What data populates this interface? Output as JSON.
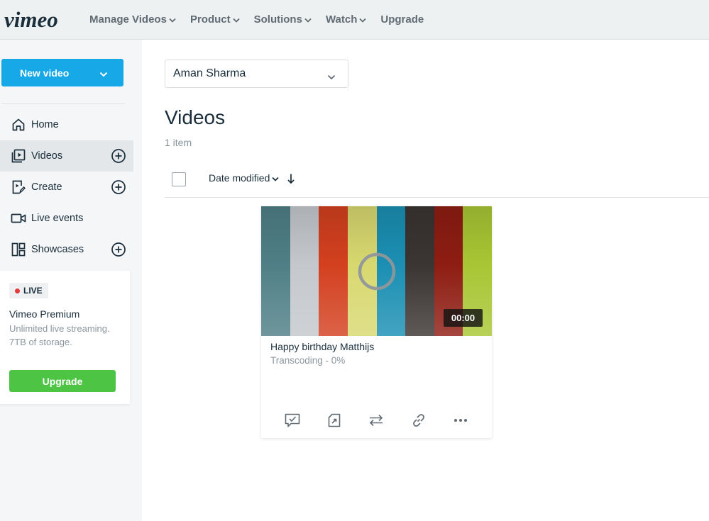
{
  "app": {
    "logo_text": "vimeo",
    "brand_color": "#17a8e8"
  },
  "topnav": {
    "items": [
      {
        "label": "Manage Videos",
        "has_dropdown": true
      },
      {
        "label": "Product",
        "has_dropdown": true
      },
      {
        "label": "Solutions",
        "has_dropdown": true
      },
      {
        "label": "Watch",
        "has_dropdown": true
      },
      {
        "label": "Upgrade",
        "has_dropdown": false
      }
    ]
  },
  "sidebar": {
    "new_video_label": "New video",
    "items": [
      {
        "label": "Home",
        "icon": "home-icon",
        "active": false,
        "has_add": false
      },
      {
        "label": "Videos",
        "icon": "video-library-icon",
        "active": true,
        "has_add": true
      },
      {
        "label": "Create",
        "icon": "create-icon",
        "active": false,
        "has_add": true
      },
      {
        "label": "Live events",
        "icon": "camera-icon",
        "active": false,
        "has_add": false
      },
      {
        "label": "Showcases",
        "icon": "showcases-icon",
        "active": false,
        "has_add": true
      }
    ],
    "promo": {
      "badge": "LIVE",
      "title": "Vimeo Premium",
      "description": "Unlimited live streaming. 7TB of storage.",
      "button_label": "Upgrade",
      "button_color": "#4ec445"
    }
  },
  "main": {
    "account_selector": "Aman Sharma",
    "title": "Videos",
    "item_count": "1 item",
    "sort_label": "Date modified",
    "videos": [
      {
        "title": "Happy birthday Matthijs",
        "status": "Transcoding - 0%",
        "duration": "00:00",
        "thumbnail_colors": [
          "#4f7f86",
          "#c4c8cc",
          "#d3401f",
          "#d8d870",
          "#1b8fb3",
          "#3a3533",
          "#8e1d13",
          "#a8c634"
        ],
        "actions": [
          {
            "name": "review-icon",
            "label": "Review"
          },
          {
            "name": "export-icon",
            "label": "Export"
          },
          {
            "name": "transfer-icon",
            "label": "Transfer"
          },
          {
            "name": "link-icon",
            "label": "Copy link"
          },
          {
            "name": "more-icon",
            "label": "More"
          }
        ]
      }
    ]
  }
}
